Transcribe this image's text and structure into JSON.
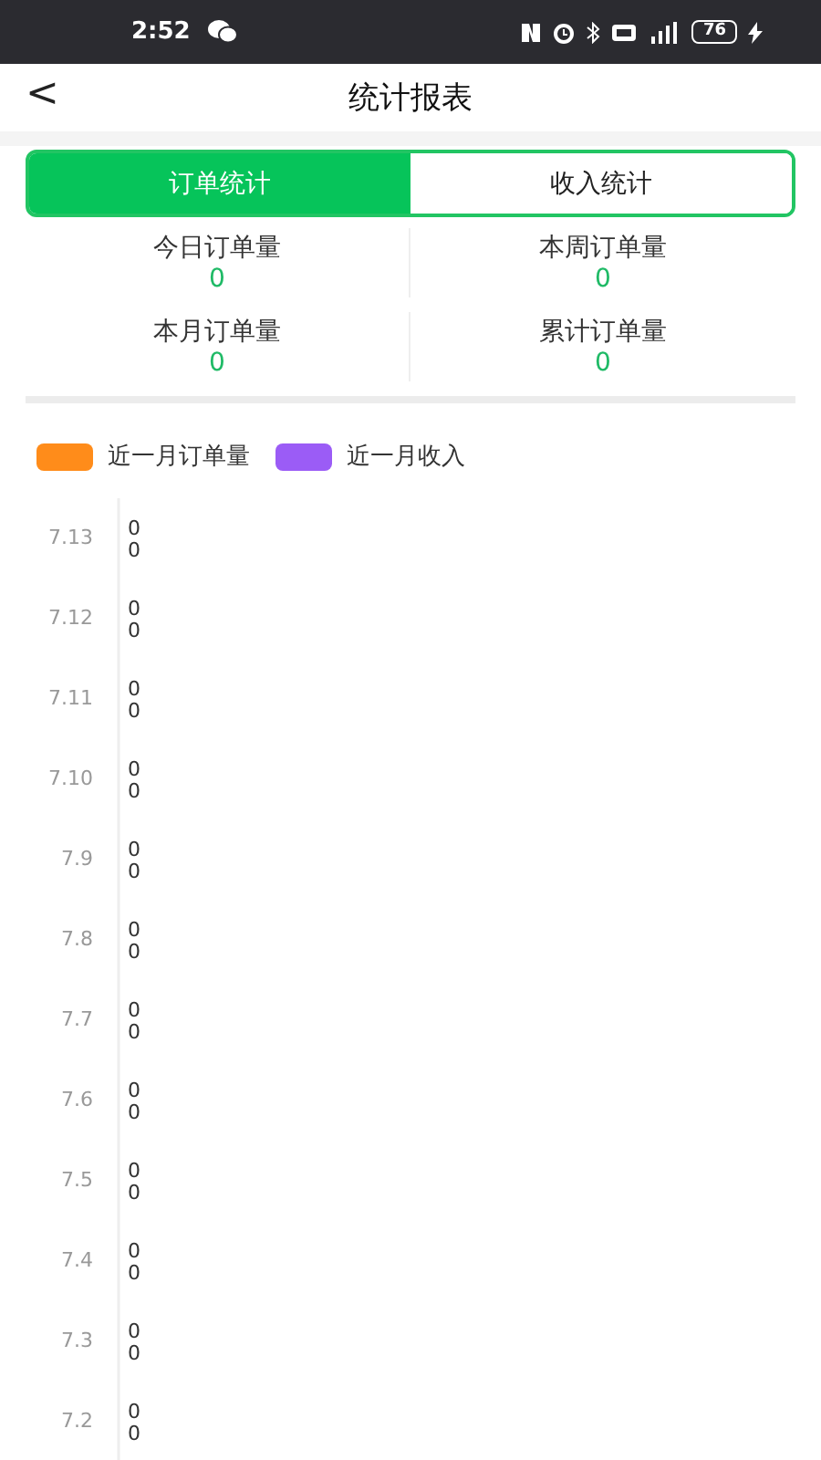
{
  "status_bar": {
    "time": "2:52",
    "battery": "76"
  },
  "header": {
    "back": "<",
    "title": "统计报表"
  },
  "tabs": [
    {
      "label": "订单统计",
      "selected": true
    },
    {
      "label": "收入统计",
      "selected": false
    }
  ],
  "stats": [
    {
      "label": "今日订单量",
      "value": "0"
    },
    {
      "label": "本周订单量",
      "value": "0"
    },
    {
      "label": "本月订单量",
      "value": "0"
    },
    {
      "label": "累计订单量",
      "value": "0"
    }
  ],
  "legend": [
    {
      "label": "近一月订单量",
      "color": "#ff8c1a"
    },
    {
      "label": "近一月收入",
      "color": "#9b5cf6"
    }
  ],
  "rows": [
    {
      "date": "7.13",
      "labels": [
        "0",
        "0"
      ]
    },
    {
      "date": "7.12",
      "labels": [
        "0",
        "0"
      ]
    },
    {
      "date": "7.11",
      "labels": [
        "0",
        "0"
      ]
    },
    {
      "date": "7.10",
      "labels": [
        "0",
        "0"
      ]
    },
    {
      "date": "7.9",
      "labels": [
        "0",
        "0"
      ]
    },
    {
      "date": "7.8",
      "labels": [
        "0",
        "0"
      ]
    },
    {
      "date": "7.7",
      "labels": [
        "0",
        "0"
      ]
    },
    {
      "date": "7.6",
      "labels": [
        "0",
        "0"
      ]
    },
    {
      "date": "7.5",
      "labels": [
        "0",
        "0"
      ]
    },
    {
      "date": "7.4",
      "labels": [
        "0",
        "0"
      ]
    },
    {
      "date": "7.3",
      "labels": [
        "0",
        "0"
      ]
    },
    {
      "date": "7.2",
      "labels": [
        "0",
        "0"
      ]
    }
  ]
}
